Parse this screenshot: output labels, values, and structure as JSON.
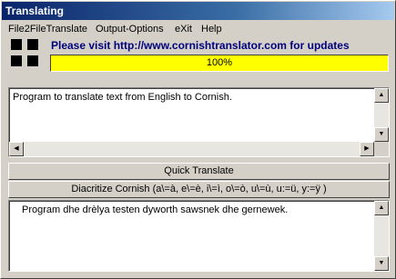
{
  "window": {
    "title": "Translating"
  },
  "menu": [
    "File2FileTranslate",
    "Output-Options",
    "eXit",
    "Help"
  ],
  "banner": {
    "text": "Please visit http://www.cornishtranslator.com for updates"
  },
  "progress": {
    "value": 1.0,
    "label": "100%"
  },
  "input": {
    "text": "Program to translate text from English to Cornish."
  },
  "buttons": {
    "quick_translate": "Quick Translate",
    "diacritize": "Diacritize Cornish (a\\=à, e\\=è, i\\=ì, o\\=ò, u\\=ù, u:=ü, y:=ÿ )"
  },
  "output": {
    "text": "Program dhe drèlya testen dyworth sawsnek dhe gernewek."
  },
  "icons": {
    "scroll_up": "scroll-up-arrow-icon",
    "scroll_down": "scroll-down-arrow-icon",
    "scroll_left": "scroll-left-arrow-icon",
    "scroll_right": "scroll-right-arrow-icon",
    "logo": "four-squares-logo-icon"
  }
}
